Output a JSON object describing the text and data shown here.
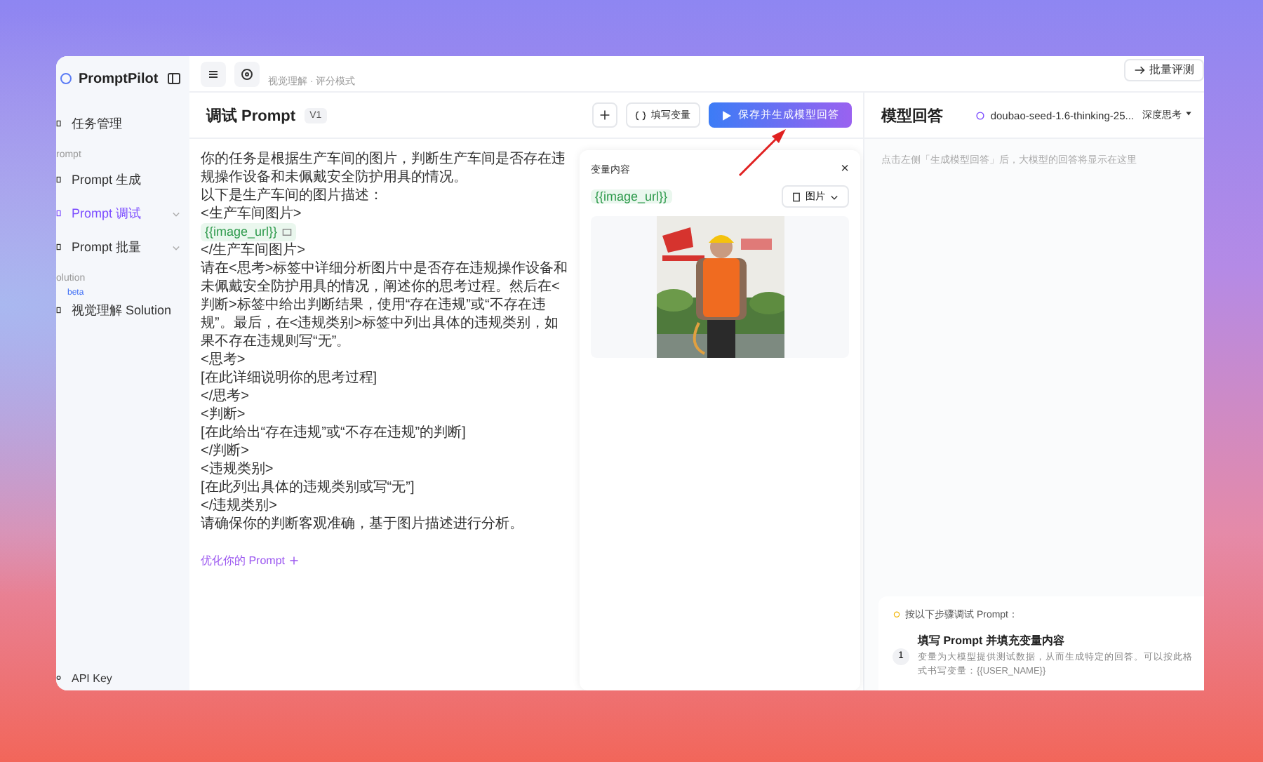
{
  "sidebar": {
    "logo": "PromptPilot",
    "items": [
      {
        "kind": "item",
        "label": "任务管理",
        "selected": false
      },
      {
        "kind": "group",
        "label": "rompt"
      },
      {
        "kind": "item",
        "label": "Prompt 生成",
        "selected": false
      },
      {
        "kind": "item",
        "label": "Prompt 调试",
        "selected": true,
        "expandable": true
      },
      {
        "kind": "item",
        "label": "Prompt 批量",
        "selected": false,
        "expandable": true
      },
      {
        "kind": "group",
        "label": "olution"
      },
      {
        "kind": "item",
        "label": "视觉理解 Solution",
        "selected": false,
        "badge": "beta"
      }
    ],
    "footer": "API Key"
  },
  "topbar": {
    "subtitle": "视觉理解 · 评分模式",
    "batch_button": "批量评测"
  },
  "prompt_panel": {
    "title": "调试 Prompt",
    "version": "V1",
    "fill_button": "填写变量",
    "run_button": "保存并生成模型回答",
    "lines": [
      {
        "kind": "text",
        "text": "你的任务是根据生产车间的图片，判断生产车间是否存在违规操作设备和未佩戴安全防护用具的情况。"
      },
      {
        "kind": "text",
        "text": "以下是生产车间的图片描述："
      },
      {
        "kind": "text",
        "text": "<生产车间图片>"
      },
      {
        "kind": "variable",
        "text": "{{image_url}}"
      },
      {
        "kind": "text",
        "text": "</生产车间图片>"
      },
      {
        "kind": "text",
        "text": "请在<思考>标签中详细分析图片中是否存在违规操作设备和未佩戴安全防护用具的情况，阐述你的思考过程。然后在<判断>标签中给出判断结果，使用“存在违规”或“不存在违规”。最后，在<违规类别>标签中列出具体的违规类别，如果不存在违规则写“无”。"
      },
      {
        "kind": "text",
        "text": "<思考>"
      },
      {
        "kind": "text",
        "text": "[在此详细说明你的思考过程]"
      },
      {
        "kind": "text",
        "text": "</思考>"
      },
      {
        "kind": "text",
        "text": "<判断>"
      },
      {
        "kind": "text",
        "text": "[在此给出“存在违规”或“不存在违规”的判断]"
      },
      {
        "kind": "text",
        "text": "</判断>"
      },
      {
        "kind": "text",
        "text": "<违规类别>"
      },
      {
        "kind": "text",
        "text": "[在此列出具体的违规类别或写“无”]"
      },
      {
        "kind": "text",
        "text": "</违规类别>"
      },
      {
        "kind": "text",
        "text": "请确保你的判断客观准确，基于图片描述进行分析。"
      }
    ],
    "optimize_link": "优化你的 Prompt",
    "variables": {
      "title": "变量内容",
      "close": "×",
      "name": "{{image_url}}",
      "type": "图片"
    }
  },
  "answer_panel": {
    "title": "模型回答",
    "model": "doubao-seed-1.6-thinking-25...",
    "mode": "深度思考",
    "placeholder": "点击左侧「生成模型回答」后，大模型的回答将显示在这里",
    "guide": {
      "title": "按以下步骤调试 Prompt：",
      "steps": [
        {
          "number": "1",
          "title": "填写 Prompt 并填充变量内容",
          "text": "变量为大模型提供测试数据，从而生成特定的回答。可以按此格式书写变量：{{USER_NAME}}"
        }
      ]
    }
  }
}
